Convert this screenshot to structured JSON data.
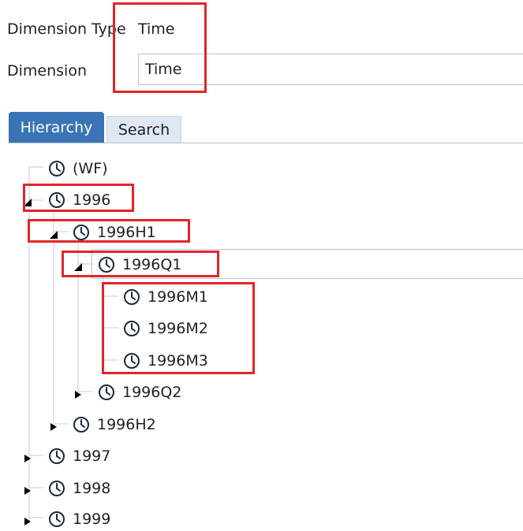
{
  "form": {
    "dimension_type_label": "Dimension Type",
    "dimension_type_value": "Time",
    "dimension_label": "Dimension",
    "dimension_value": "Time"
  },
  "tabs": [
    {
      "label": "Hierarchy",
      "active": true
    },
    {
      "label": "Search",
      "active": false
    }
  ],
  "tree": {
    "nodes": [
      {
        "label": "(WF)",
        "level": 0,
        "expander": "none"
      },
      {
        "label": "1996",
        "level": 0,
        "expander": "expanded"
      },
      {
        "label": "1996H1",
        "level": 1,
        "expander": "expanded"
      },
      {
        "label": "1996Q1",
        "level": 2,
        "expander": "expanded",
        "selected": true
      },
      {
        "label": "1996M1",
        "level": 3,
        "expander": "none"
      },
      {
        "label": "1996M2",
        "level": 3,
        "expander": "none"
      },
      {
        "label": "1996M3",
        "level": 3,
        "expander": "none"
      },
      {
        "label": "1996Q2",
        "level": 2,
        "expander": "collapsed"
      },
      {
        "label": "1996H2",
        "level": 1,
        "expander": "collapsed"
      },
      {
        "label": "1997",
        "level": 0,
        "expander": "collapsed"
      },
      {
        "label": "1998",
        "level": 0,
        "expander": "collapsed"
      },
      {
        "label": "1999",
        "level": 0,
        "expander": "collapsed"
      }
    ]
  },
  "colors": {
    "highlight": "#e0252b",
    "tab_active": "#3a74b5",
    "tab_inactive": "#dfe7f3",
    "tree_line": "#c5ccd6"
  },
  "icons": {
    "tree_node": "clock-icon",
    "expanded": "triangle-expanded-icon",
    "collapsed": "triangle-collapsed-icon"
  }
}
